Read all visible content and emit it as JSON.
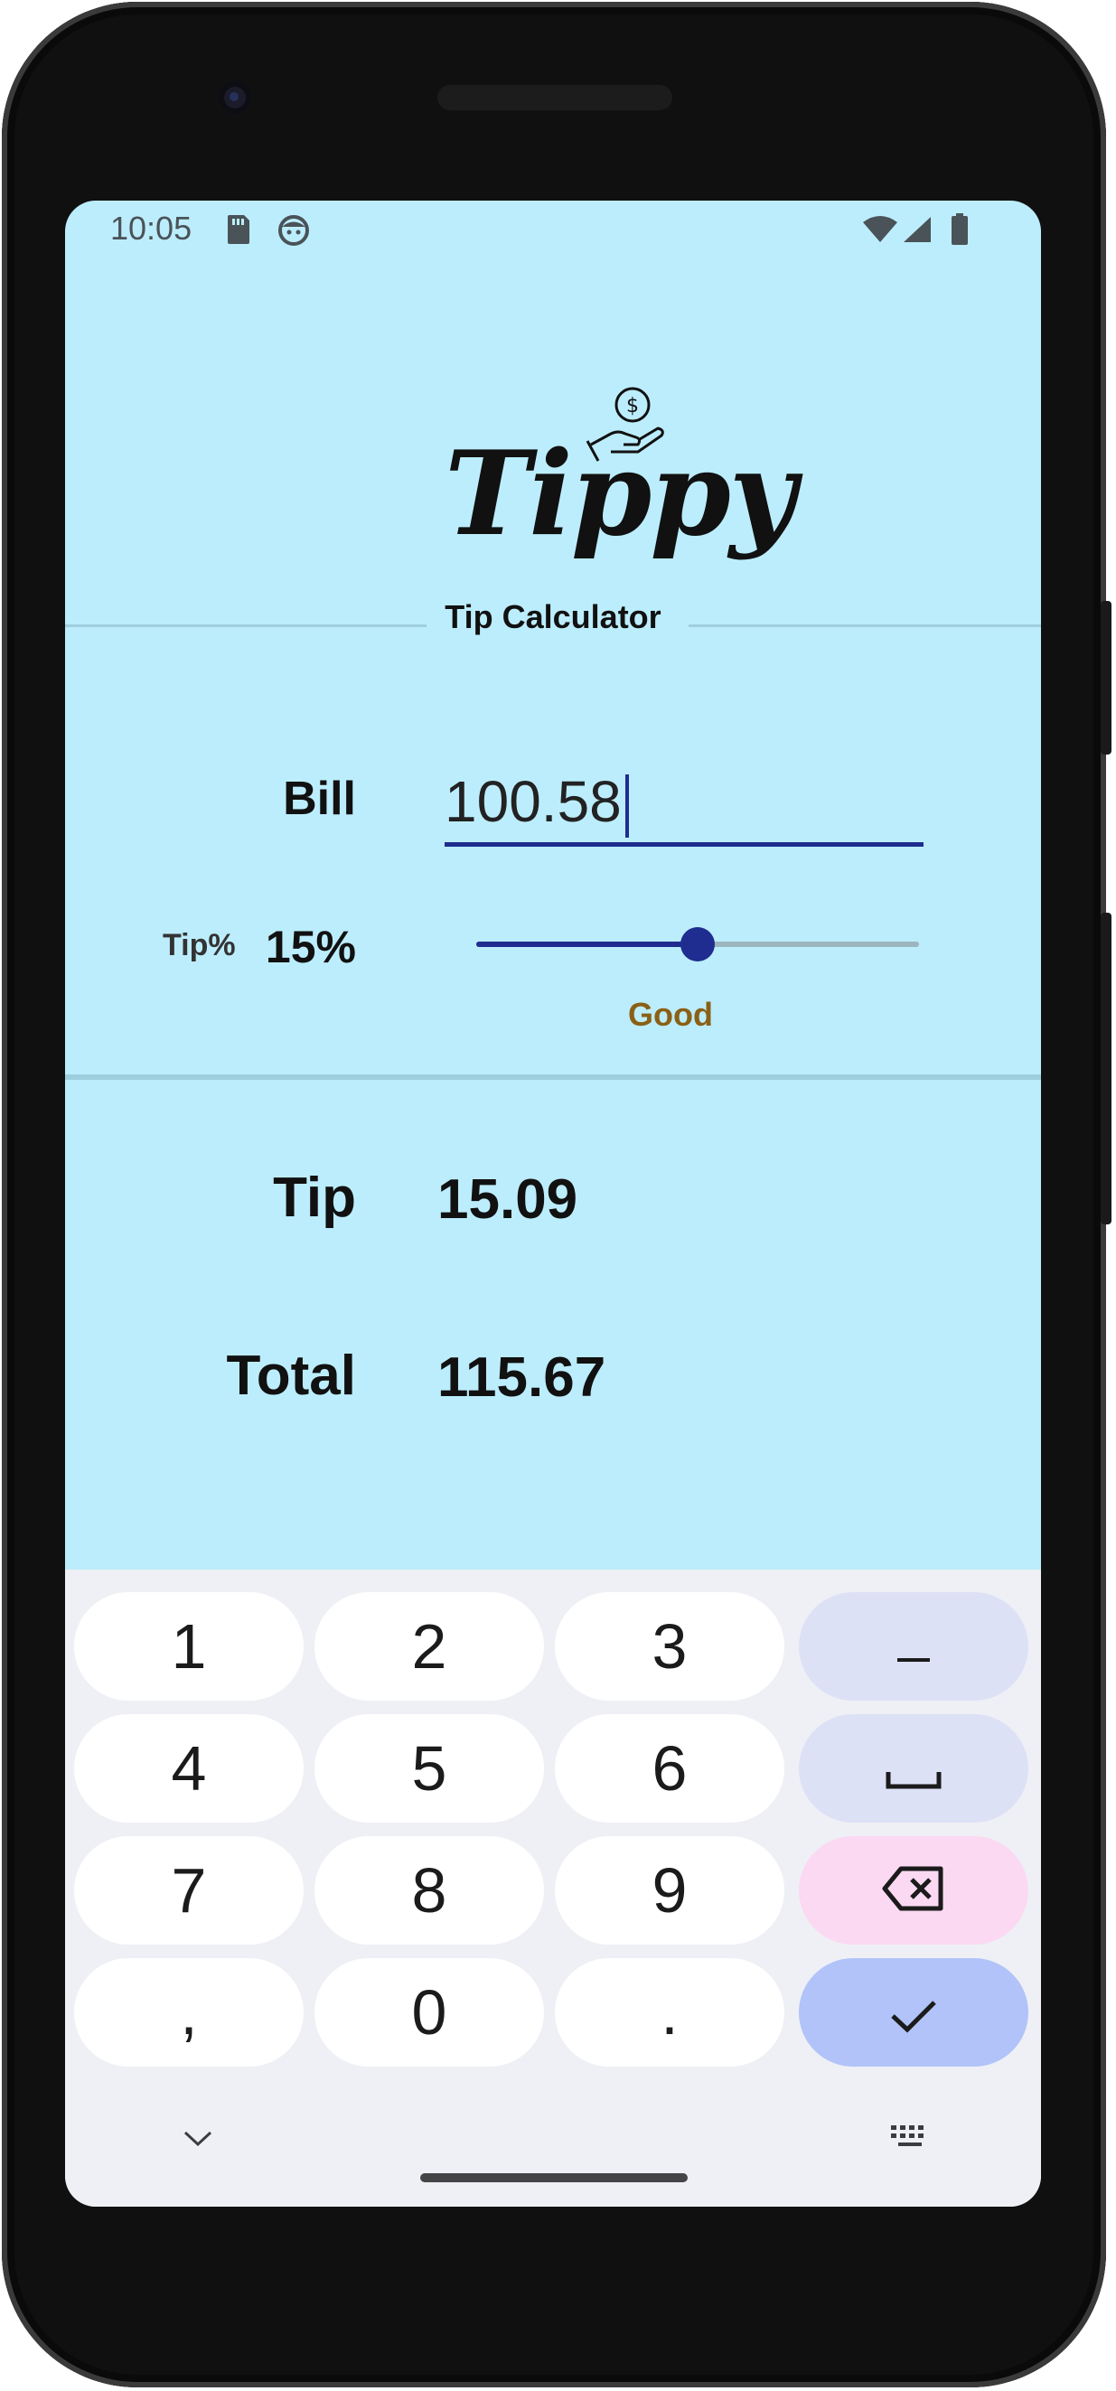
{
  "status_bar": {
    "time": "10:05",
    "left_icons": [
      "sd-card-icon",
      "face-icon"
    ],
    "right_icons": [
      "wifi-icon",
      "signal-icon",
      "battery-icon"
    ]
  },
  "app": {
    "logo_text": "Tippy",
    "logo_icon": "hand-coin-icon",
    "subtitle": "Tip Calculator"
  },
  "bill": {
    "label": "Bill",
    "value": "100.58"
  },
  "tip_percent": {
    "label": "Tip%",
    "value_label": "15%",
    "slider_value": 15,
    "slider_max": 30,
    "description": "Good",
    "description_color": "#8a6016"
  },
  "results": {
    "tip_label": "Tip",
    "tip_value": "15.09",
    "total_label": "Total",
    "total_value": "115.67"
  },
  "keyboard": {
    "rows": [
      [
        "1",
        "2",
        "3",
        "–"
      ],
      [
        "4",
        "5",
        "6",
        "␣"
      ],
      [
        "7",
        "8",
        "9",
        "⌫"
      ],
      [
        ",",
        "0",
        ".",
        "✓"
      ]
    ],
    "bottom_left_icon": "chevron-down-icon",
    "bottom_right_icon": "keyboard-icon"
  },
  "colors": {
    "background": "#bcedfc",
    "accent": "#1e2d8f",
    "keyboard_bg": "#eff0f5"
  }
}
